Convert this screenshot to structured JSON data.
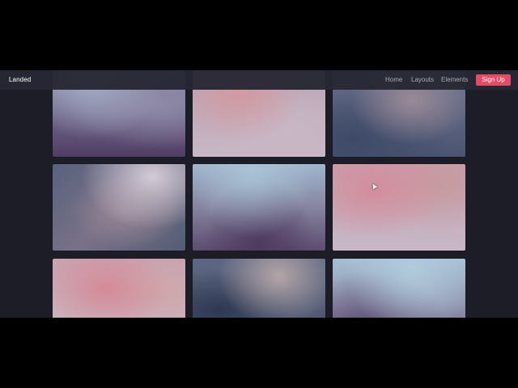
{
  "navbar": {
    "logo": "Landed",
    "links": [
      "Home",
      "Layouts",
      "Elements"
    ],
    "cta": "Sign Up",
    "accent_color": "#e44c65"
  },
  "gallery": {
    "tiles": [
      {
        "row": 1,
        "col": 1,
        "style": "purple"
      },
      {
        "row": 1,
        "col": 2,
        "style": "pink-gray"
      },
      {
        "row": 1,
        "col": 3,
        "style": "slate"
      },
      {
        "row": 2,
        "col": 1,
        "style": "dusk"
      },
      {
        "row": 2,
        "col": 2,
        "style": "sky"
      },
      {
        "row": 2,
        "col": 3,
        "style": "rose"
      },
      {
        "row": 3,
        "col": 1,
        "style": "rose"
      },
      {
        "row": 3,
        "col": 2,
        "style": "slate"
      },
      {
        "row": 3,
        "col": 3,
        "style": "sky"
      }
    ]
  },
  "colors": {
    "page_background": "#1c1d26",
    "navbar_background": "#272833",
    "link_color": "#a9aab3"
  }
}
